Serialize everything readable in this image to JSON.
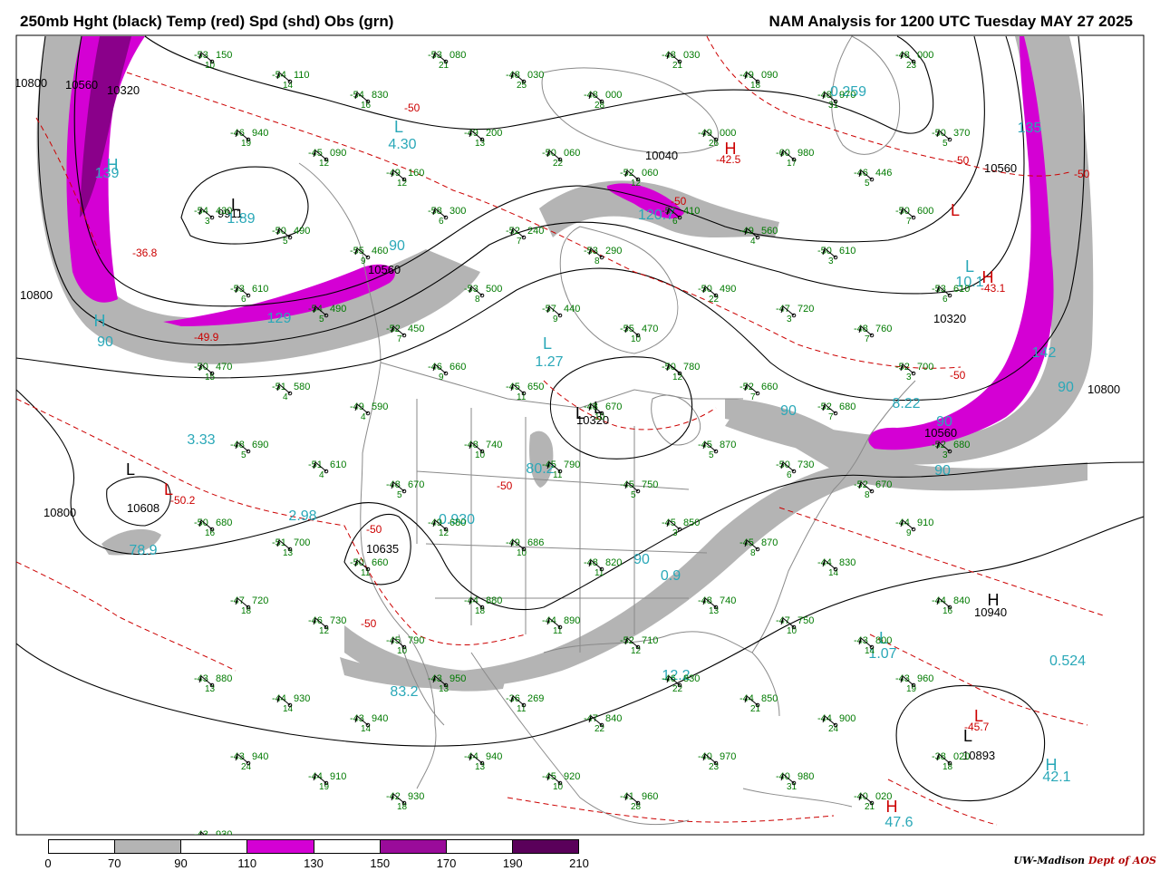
{
  "header": {
    "left": "250mb Hght (black) Temp (red) Spd (shd) Obs (grn)",
    "right": "NAM Analysis for 1200 UTC Tuesday  MAY 27 2025"
  },
  "legend": {
    "ticks": [
      "0",
      "70",
      "90",
      "110",
      "130",
      "150",
      "170",
      "190",
      "210"
    ],
    "colors": [
      "#ffffff",
      "#b4b4b4",
      "#ffffff",
      "#d400d4",
      "#ffffff",
      "#9a0b9a",
      "#ffffff",
      "#5a005a"
    ]
  },
  "credit": {
    "org": "UW-Madison",
    "dept": "Dept of AOS"
  },
  "colors": {
    "height": "#000000",
    "temp": "#cc0000",
    "obs": "#007a00",
    "speed_label": "#2aa8b8",
    "shade_70": "#b4b4b4",
    "shade_110": "#d400d4",
    "shade_150": "#8a008a",
    "geo": "#8a8a8a"
  },
  "height_labels": [
    "10800",
    "10560",
    "10320",
    "9911",
    "10800",
    "10560",
    "10320",
    "10040",
    "10320",
    "10800",
    "10560",
    "10608",
    "10800",
    "10635",
    "10940",
    "10893",
    "10560"
  ],
  "center_marks": [
    {
      "t": "L",
      "c": "black"
    },
    {
      "t": "L",
      "c": "black"
    },
    {
      "t": "L",
      "c": "black"
    },
    {
      "t": "L",
      "c": "black"
    },
    {
      "t": "H",
      "c": "black"
    },
    {
      "t": "L",
      "c": "black"
    },
    {
      "t": "H",
      "c": "red"
    },
    {
      "t": "L",
      "c": "red"
    },
    {
      "t": "H",
      "c": "red"
    },
    {
      "t": "L",
      "c": "red"
    },
    {
      "t": "L",
      "c": "red"
    },
    {
      "t": "H",
      "c": "red"
    },
    {
      "t": "L",
      "c": "cyan"
    },
    {
      "t": "H",
      "c": "cyan"
    },
    {
      "t": "L",
      "c": "cyan"
    },
    {
      "t": "L",
      "c": "cyan"
    },
    {
      "t": "H",
      "c": "cyan"
    },
    {
      "t": "L",
      "c": "cyan"
    },
    {
      "t": "H",
      "c": "cyan"
    }
  ],
  "temp_labels": [
    "-36.8",
    "-49.9",
    "-50.2",
    "-42.5",
    "-43.1",
    "-45.7",
    "-50",
    "-50",
    "-50",
    "-50",
    "-50",
    "-50",
    "-50",
    "-50"
  ],
  "speed_labels": [
    "139",
    "4.30",
    "1.89",
    "90",
    "129",
    "90",
    "1.27",
    "80.2",
    "3.33",
    "2.98",
    "0.930",
    "78.9",
    "120.7",
    "0.259",
    "10.1",
    "8.22",
    "90",
    "90",
    "1.07",
    "12.2",
    "0.524",
    "42.1",
    "47.6",
    "135",
    "142",
    "90",
    "90",
    "90",
    "83.2",
    "0.9"
  ],
  "obs": [
    [
      "-53",
      "150",
      "10"
    ],
    [
      "-54",
      "110",
      "14"
    ],
    [
      "-54",
      "830",
      "16"
    ],
    [
      "-53",
      "080",
      "21"
    ],
    [
      "-48",
      "030",
      "25"
    ],
    [
      "-48",
      "000",
      "28"
    ],
    [
      "-48",
      "030",
      "21"
    ],
    [
      "-49",
      "090",
      "18"
    ],
    [
      "-48",
      "970",
      "31"
    ],
    [
      "-48",
      "000",
      "23"
    ],
    [
      "-46",
      "940",
      "19"
    ],
    [
      "-45",
      "090",
      "12"
    ],
    [
      "-49",
      "160",
      "12"
    ],
    [
      "-49",
      "200",
      "13"
    ],
    [
      "-50",
      "060",
      "22"
    ],
    [
      "-52",
      "060",
      "12"
    ],
    [
      "-49",
      "000",
      "26"
    ],
    [
      "-60",
      "980",
      "17"
    ],
    [
      "-46",
      "446",
      "5"
    ],
    [
      "-50",
      "370",
      "5"
    ],
    [
      "-54",
      "430",
      "3"
    ],
    [
      "-50",
      "490",
      "5"
    ],
    [
      "-55",
      "460",
      "9"
    ],
    [
      "-58",
      "300",
      "6"
    ],
    [
      "-52",
      "240",
      "7"
    ],
    [
      "-53",
      "290",
      "8"
    ],
    [
      "-57",
      "410",
      "6"
    ],
    [
      "-49",
      "560",
      "4"
    ],
    [
      "-50",
      "610",
      "3"
    ],
    [
      "-50",
      "600",
      "7"
    ],
    [
      "-53",
      "610",
      "6"
    ],
    [
      "-54",
      "490",
      "5"
    ],
    [
      "-52",
      "450",
      "7"
    ],
    [
      "-53",
      "500",
      "8"
    ],
    [
      "-57",
      "440",
      "9"
    ],
    [
      "-55",
      "470",
      "10"
    ],
    [
      "-50",
      "490",
      "22"
    ],
    [
      "-47",
      "720",
      "3"
    ],
    [
      "-48",
      "760",
      "7"
    ],
    [
      "-53",
      "610",
      "6"
    ],
    [
      "-50",
      "470",
      "15"
    ],
    [
      "-51",
      "580",
      "4"
    ],
    [
      "-49",
      "590",
      "4"
    ],
    [
      "-46",
      "660",
      "9"
    ],
    [
      "-45",
      "650",
      "11"
    ],
    [
      "-48",
      "670",
      "10"
    ],
    [
      "-50",
      "780",
      "12"
    ],
    [
      "-52",
      "660",
      "7"
    ],
    [
      "-52",
      "680",
      "7"
    ],
    [
      "-52",
      "700",
      "3"
    ],
    [
      "-48",
      "690",
      "5"
    ],
    [
      "-51",
      "610",
      "4"
    ],
    [
      "-48",
      "670",
      "5"
    ],
    [
      "-48",
      "740",
      "10"
    ],
    [
      "-45",
      "790",
      "11"
    ],
    [
      "-45",
      "750",
      "5"
    ],
    [
      "-45",
      "870",
      "5"
    ],
    [
      "-50",
      "730",
      "6"
    ],
    [
      "-52",
      "670",
      "8"
    ],
    [
      "-52",
      "680",
      "3"
    ],
    [
      "-50",
      "680",
      "16"
    ],
    [
      "-51",
      "700",
      "13"
    ],
    [
      "-50",
      "660",
      "11"
    ],
    [
      "-49",
      "680",
      "12"
    ],
    [
      "-49",
      "686",
      "10"
    ],
    [
      "-48",
      "820",
      "11"
    ],
    [
      "-45",
      "850",
      "3"
    ],
    [
      "-45",
      "870",
      "8"
    ],
    [
      "-44",
      "830",
      "14"
    ],
    [
      "-44",
      "910",
      "9"
    ],
    [
      "-47",
      "720",
      "18"
    ],
    [
      "-46",
      "730",
      "12"
    ],
    [
      "-45",
      "790",
      "10"
    ],
    [
      "-44",
      "880",
      "18"
    ],
    [
      "-44",
      "890",
      "11"
    ],
    [
      "-52",
      "710",
      "12"
    ],
    [
      "-48",
      "740",
      "13"
    ],
    [
      "-47",
      "750",
      "10"
    ],
    [
      "-43",
      "800",
      "14"
    ],
    [
      "-44",
      "840",
      "16"
    ],
    [
      "-43",
      "880",
      "13"
    ],
    [
      "-44",
      "930",
      "14"
    ],
    [
      "-43",
      "940",
      "14"
    ],
    [
      "-43",
      "950",
      "13"
    ],
    [
      "-36",
      "269",
      "11"
    ],
    [
      "-47",
      "840",
      "22"
    ],
    [
      "-46",
      "830",
      "22"
    ],
    [
      "-44",
      "850",
      "21"
    ],
    [
      "-44",
      "900",
      "24"
    ],
    [
      "-43",
      "960",
      "19"
    ],
    [
      "-43",
      "940",
      "24"
    ],
    [
      "-44",
      "910",
      "19"
    ],
    [
      "-42",
      "930",
      "18"
    ],
    [
      "-44",
      "940",
      "13"
    ],
    [
      "-45",
      "920",
      "10"
    ],
    [
      "-41",
      "960",
      "28"
    ],
    [
      "-40",
      "970",
      "23"
    ],
    [
      "-40",
      "980",
      "31"
    ],
    [
      "-40",
      "020",
      "21"
    ],
    [
      "-38",
      "020",
      "18"
    ],
    [
      "-43",
      "930",
      "18"
    ],
    [
      "-41",
      "990",
      "11"
    ],
    [
      "-40",
      "010",
      "17"
    ]
  ]
}
